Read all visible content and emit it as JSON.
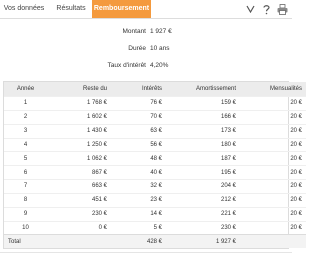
{
  "tabs": [
    {
      "label": "Vos données",
      "active": false
    },
    {
      "label": "Résultats",
      "active": false
    },
    {
      "label": "Remboursement",
      "active": true
    }
  ],
  "icons": [
    "chevron-down-icon",
    "help-icon",
    "print-icon"
  ],
  "colors": {
    "accent": "#f49a3e",
    "header_bg": "#ececec"
  },
  "summary": {
    "montant_label": "Montant",
    "montant_value": "1 927 €",
    "duree_label": "Durée",
    "duree_value": "10 ans",
    "taux_label": "Taux d'intérêt",
    "taux_value": "4,20%"
  },
  "table": {
    "headers": [
      "Année",
      "Reste du",
      "Intérêts",
      "Amortissement",
      "Mensualités"
    ],
    "rows": [
      [
        "1",
        "1 768 €",
        "76 €",
        "159 €",
        "20 €"
      ],
      [
        "2",
        "1 602 €",
        "70 €",
        "166 €",
        "20 €"
      ],
      [
        "3",
        "1 430 €",
        "63 €",
        "173 €",
        "20 €"
      ],
      [
        "4",
        "1 250 €",
        "56 €",
        "180 €",
        "20 €"
      ],
      [
        "5",
        "1 062 €",
        "48 €",
        "187 €",
        "20 €"
      ],
      [
        "6",
        "867 €",
        "40 €",
        "195 €",
        "20 €"
      ],
      [
        "7",
        "663 €",
        "32 €",
        "204 €",
        "20 €"
      ],
      [
        "8",
        "451 €",
        "23 €",
        "212 €",
        "20 €"
      ],
      [
        "9",
        "230 €",
        "14 €",
        "221 €",
        "20 €"
      ],
      [
        "10",
        "0 €",
        "5 €",
        "230 €",
        "20 €"
      ]
    ],
    "total_label": "Total",
    "total_interets": "428 €",
    "total_amortissement": "1 927 €"
  }
}
